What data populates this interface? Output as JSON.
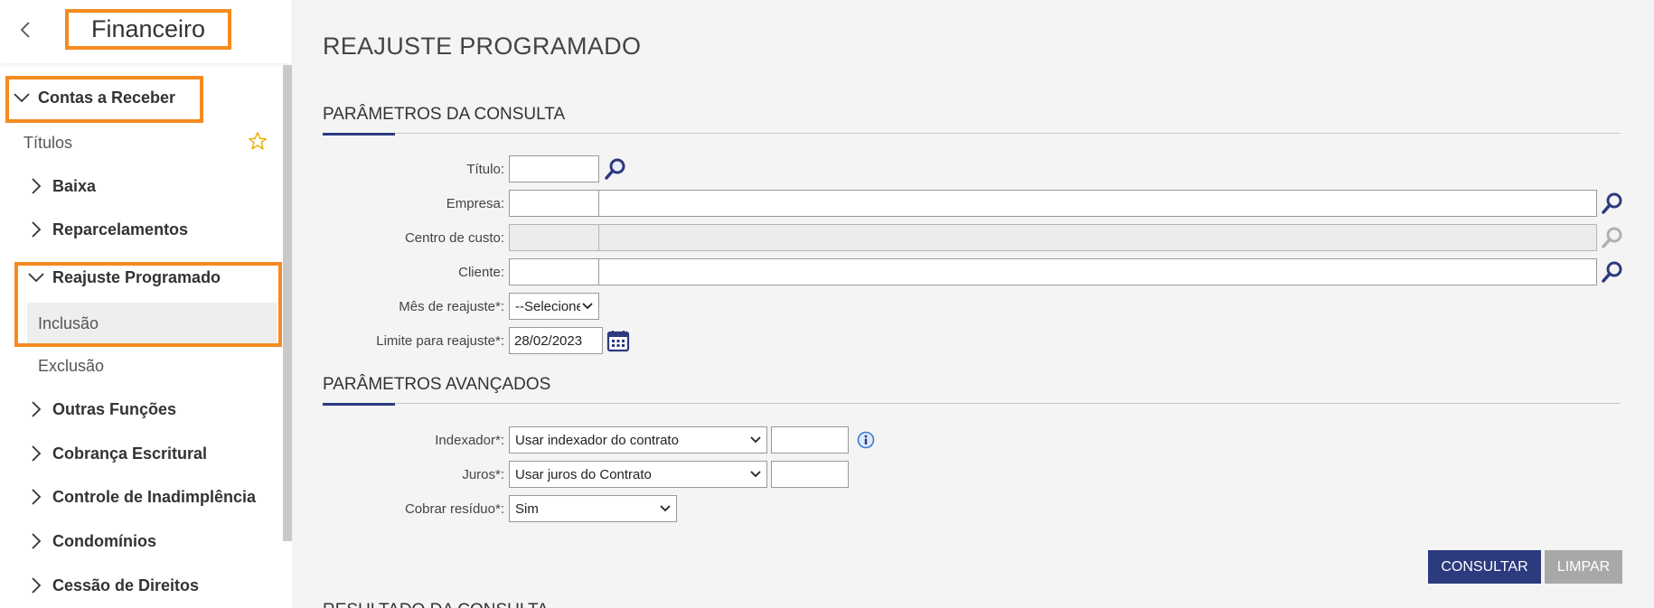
{
  "sidebar": {
    "title": "Financeiro",
    "section": {
      "label": "Contas a Receber"
    },
    "items": [
      {
        "label": "Títulos"
      },
      {
        "label": "Baixa"
      },
      {
        "label": "Reparcelamentos"
      },
      {
        "label": "Reajuste Programado"
      },
      {
        "label": "Inclusão"
      },
      {
        "label": "Exclusão"
      },
      {
        "label": "Outras Funções"
      },
      {
        "label": "Cobrança Escritural"
      },
      {
        "label": "Controle de Inadimplência"
      },
      {
        "label": "Condomínios"
      },
      {
        "label": "Cessão de Direitos"
      }
    ]
  },
  "page": {
    "title": "REAJUSTE PROGRAMADO"
  },
  "query_params": {
    "title": "PARÂMETROS DA CONSULTA",
    "titulo": {
      "label": "Título:",
      "value": ""
    },
    "empresa": {
      "label": "Empresa:",
      "code": "",
      "name": ""
    },
    "centro_custo": {
      "label": "Centro de custo:",
      "code": "",
      "name": ""
    },
    "cliente": {
      "label": "Cliente:",
      "code": "",
      "name": ""
    },
    "mes_reajuste": {
      "label": "Mês de reajuste*:",
      "selected": "--Selecione--"
    },
    "limite_reajuste": {
      "label": "Limite para reajuste*:",
      "value": "28/02/2023"
    }
  },
  "advanced_params": {
    "title": "PARÂMETROS AVANÇADOS",
    "indexador": {
      "label": "Indexador*:",
      "selected": "Usar indexador do contrato",
      "value": ""
    },
    "juros": {
      "label": "Juros*:",
      "selected": "Usar juros do Contrato",
      "value": ""
    },
    "cobrar_residuo": {
      "label": "Cobrar resíduo*:",
      "selected": "Sim"
    }
  },
  "buttons": {
    "consultar": "CONSULTAR",
    "limpar": "LIMPAR"
  },
  "results": {
    "title": "RESULTADO DA CONSULTA"
  },
  "colors": {
    "accent": "#2c3a7e",
    "highlight": "#f58a1f",
    "star": "#e8b000"
  },
  "icons": [
    "back-chevron-icon",
    "chevron-down-icon",
    "chevron-right-icon",
    "star-icon",
    "search-icon",
    "calendar-icon",
    "info-icon"
  ]
}
